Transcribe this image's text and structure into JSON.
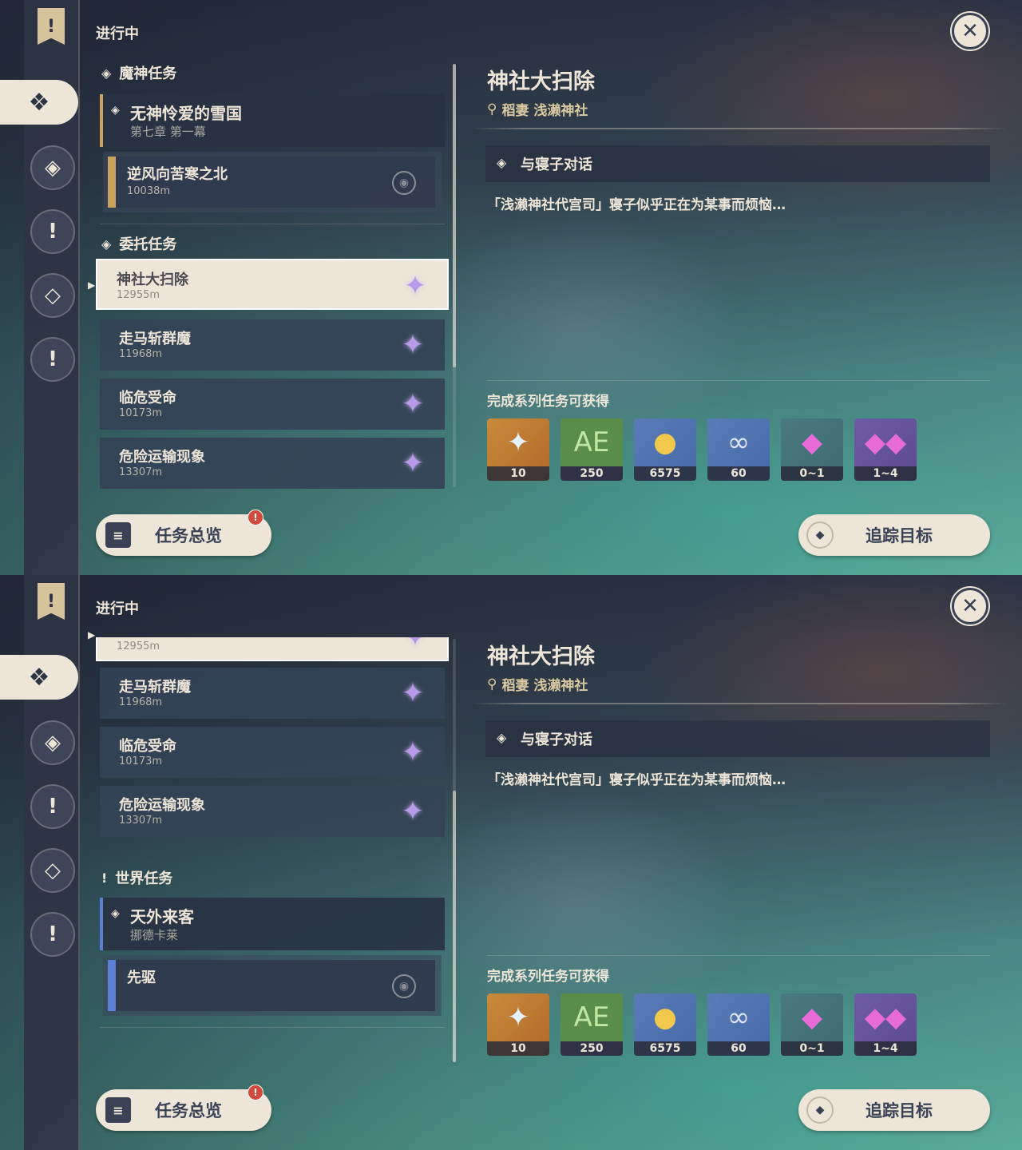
{
  "colors": {
    "cream": "#ece5d8",
    "panel": "#344256",
    "gold": "#c9a35c",
    "world_blue": "#5c7fd6"
  },
  "screens": [
    {
      "status_label": "进行中",
      "sections": {
        "archon_label": "魔神任务",
        "commission_label": "委托任务",
        "world_label": "世界任务"
      },
      "archon_quest": {
        "name": "无神怜爱的雪国",
        "sub": "第七章 第一幕",
        "step": "逆风向苦寒之北",
        "step_dist": "10038m"
      },
      "commissions": [
        {
          "name": "神社大扫除",
          "dist": "12955m"
        },
        {
          "name": "走马斩群魔",
          "dist": "11968m"
        },
        {
          "name": "临危受命",
          "dist": "10173m"
        },
        {
          "name": "危险运输现象",
          "dist": "13307m"
        }
      ],
      "world_quest": {
        "name": "天外来客",
        "sub": "挪德卡莱",
        "step": "先驱"
      }
    }
  ],
  "detail": {
    "title": "神社大扫除",
    "location": "稻妻 浅濑神社",
    "objective": "与寝子对话",
    "description": "「浅濑神社代宫司」寝子似乎正在为某事而烦恼…",
    "rewards_heading": "完成系列任务可获得",
    "rewards": [
      {
        "icon": "primogem-icon",
        "count": "10"
      },
      {
        "icon": "adventure-exp-icon",
        "count": "250"
      },
      {
        "icon": "mora-icon",
        "count": "6575"
      },
      {
        "icon": "friendship-exp-icon",
        "count": "60"
      },
      {
        "icon": "crystal-icon",
        "count": "0~1"
      },
      {
        "icon": "crystals-icon",
        "count": "1~4"
      }
    ]
  },
  "buttons": {
    "overview": "任务总览",
    "overview_badge": "!",
    "track": "追踪目标"
  }
}
